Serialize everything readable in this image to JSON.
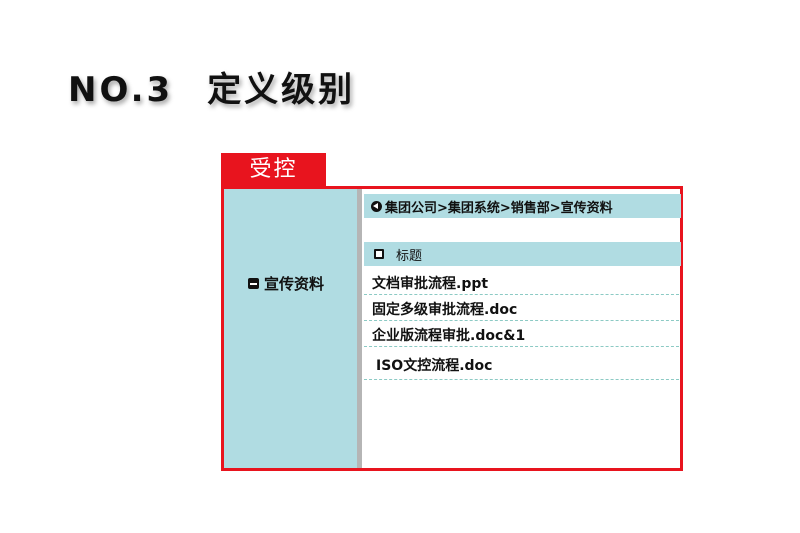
{
  "heading": {
    "number": "NO.3",
    "title": "定义级别"
  },
  "tab": {
    "label": "受控"
  },
  "sidebar": {
    "item": {
      "label": "宣传资料",
      "icon": "minus-icon"
    }
  },
  "breadcrumb": {
    "icon": "back-arrow-icon",
    "text": "集团公司>集团系统>销售部>宣传资料"
  },
  "list": {
    "header": {
      "label": "标题",
      "icon": "checkbox-icon"
    },
    "items": [
      "文档审批流程.ppt",
      "固定多级审批流程.doc",
      "企业版流程审批.doc&1",
      "ISO文控流程.doc"
    ]
  },
  "colors": {
    "accent": "#e8141e",
    "panel": "#b0dce2",
    "divider": "#b5b5b5",
    "row_border": "#8ccac4"
  }
}
